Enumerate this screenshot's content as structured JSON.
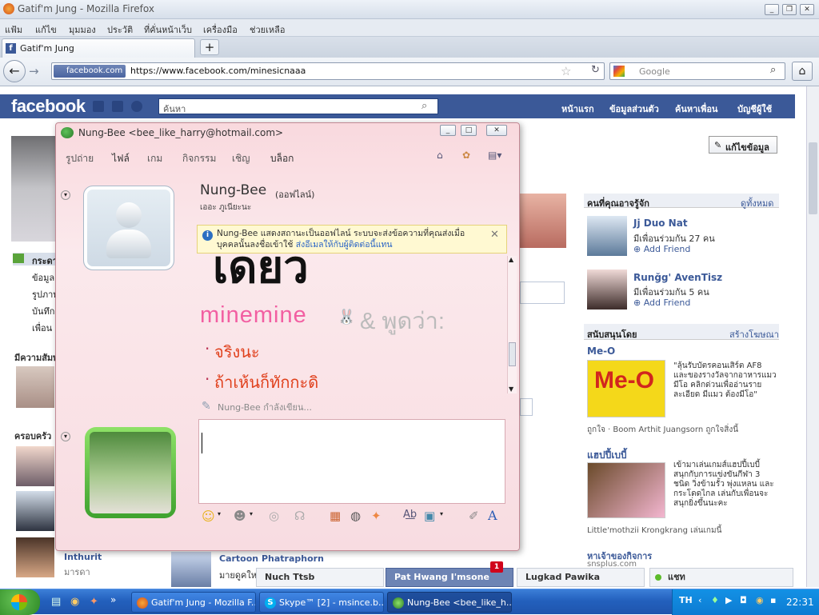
{
  "browser": {
    "window_title": "Gatif'm Jung - Mozilla Firefox",
    "menu": [
      "แฟ้ม",
      "แก้ไข",
      "มุมมอง",
      "ประวัติ",
      "ที่คั่นหน้าเว็บ",
      "เครื่องมือ",
      "ช่วยเหลือ"
    ],
    "tab_title": "Gatif'm Jung",
    "site_badge": "facebook.com",
    "url": "https://www.facebook.com/minesicnaaa",
    "search_engine_placeholder": "Google"
  },
  "facebook": {
    "logo": "facebook",
    "search_placeholder": "ค้นหา",
    "nav": [
      "หน้าแรก",
      "ข้อมูลส่วนตัว",
      "ค้นหาเพื่อน",
      "บัญชีผู้ใช้"
    ],
    "edit_profile": "แก้ไขข้อมูล",
    "left_links": [
      "กระดาน",
      "ข้อมูล",
      "รูปภาพ",
      "บันทึก",
      "เพื่อน"
    ],
    "mutual_section": "มีความสัมพันธ์",
    "family_section": "ครอบครัว",
    "friend_name": "Inthurit",
    "friend_sub": "มารดา",
    "right_header": "คนที่คุณอาจรู้จัก",
    "right_see_all": "ดูทั้งหมด",
    "suggestions": [
      {
        "name": "Jj Duo Nat",
        "mutual": "มีเพื่อนร่วมกัน 27 คน",
        "action": "Add Friend"
      },
      {
        "name": "Runğg' AvenTisz",
        "mutual": "มีเพื่อนร่วมกัน 5 คน",
        "action": "Add Friend"
      }
    ],
    "sponsor_header": "สนับสนุนโดย",
    "sponsor_create": "สร้างโฆษณา",
    "ads": [
      {
        "title": "Me-O",
        "text": "\"ลุ้นรับบัตรคอนเสิร์ต AF8 และของรางวัลจากอาหารแมวมีโอ คลิกด่วนเพื่ออ่านรายละเอียด มีแมว ต้องมีโอ\"",
        "like": "ถูกใจ · Boom Arthit Juangsorn ถูกใจสิ่งนี้"
      },
      {
        "title": "แฮปปี้เบบี้",
        "text": "เข้ามาเล่นเกมส์แฮปปี้เบบี้ สนุกกับการแข่งขันกีฬา 3 ชนิด วิ่งข้ามรั้ว พุ่งแหลน และกระโดดไกล เล่นกับเพื่อนจะสนุกยิ่งขึ้นนะคะ",
        "footer": "Little'mothzii Krongkrang เล่นเกมนี้"
      },
      {
        "title": "หาเจ้าของกิจการ",
        "footer": "snsplus.com"
      }
    ],
    "feed_name": "Cartoon Phatraphorn",
    "feed_snip": "มายดูคใหม"
  },
  "chatbar": {
    "tabs": [
      "Nuch Ttsb",
      "Pat Hwang I'msone",
      "Lugkad Pawika"
    ],
    "notif": "1",
    "chat_label": "แชท"
  },
  "msn": {
    "title": "Nung-Bee <bee_like_harry@hotmail.com>",
    "menu": [
      "รูปถ่าย",
      "ไฟล์",
      "เกม",
      "กิจกรรม",
      "เชิญ",
      "บล็อก"
    ],
    "contact_name": "Nung-Bee",
    "contact_status": "(ออฟไลน์)",
    "contact_sub": "เออะ ภูเนียะนะ",
    "info_text": "Nung-Bee แสดงสถานะเป็นออฟไลน์ ระบบจะส่งข้อความที่คุณส่งเมื่อบุคคลนั้นลงชื่อเข้าใช้",
    "info_link": "ส่งอีเมลให้กับผู้ติดต่อนี้แทน",
    "big_word": "เดยว",
    "sender": "minemine",
    "says": "& พูดว่า:",
    "messages": [
      "จริงนะ",
      "ถ้าเห้นก็ทักกะดิ"
    ],
    "typing": "Nung-Bee กำลังเขียน..."
  },
  "taskbar": {
    "buttons": [
      "Gatif'm Jung - Mozilla F...",
      "Skype™ [2] - msince.b...",
      "Nung-Bee <bee_like_h..."
    ],
    "clock": "22:31"
  }
}
